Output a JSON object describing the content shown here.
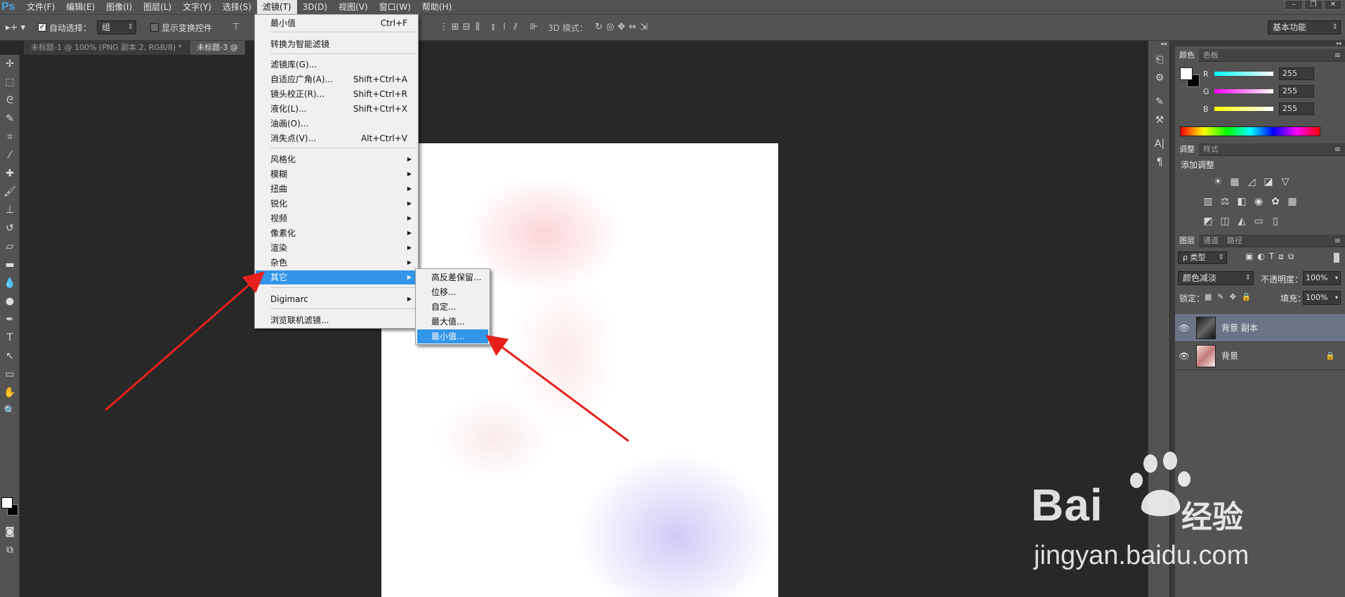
{
  "app": {
    "logo": "Ps"
  },
  "menubar": {
    "items": [
      "文件(F)",
      "编辑(E)",
      "图像(I)",
      "图层(L)",
      "文字(Y)",
      "选择(S)",
      "滤镜(T)",
      "3D(D)",
      "视图(V)",
      "窗口(W)",
      "帮助(H)"
    ],
    "active_index": 6
  },
  "options": {
    "auto_select_label": "自动选择：",
    "auto_select_value": "组",
    "show_transform_label": "显示变换控件",
    "mode_3d_label": "3D 模式：",
    "workspace": "基本功能"
  },
  "tabs": [
    "未标题-1 @ 100% (PNG 副本 2, RGB/8) *",
    "未标题-3 @"
  ],
  "filter_menu": {
    "last_filter": {
      "label": "最小值",
      "shortcut": "Ctrl+F"
    },
    "convert_smart": "转换为智能滤镜",
    "gallery": {
      "label": "滤镜库(G)..."
    },
    "adaptive_wide": {
      "label": "自适应广角(A)...",
      "shortcut": "Shift+Ctrl+A"
    },
    "lens_correction": {
      "label": "镜头校正(R)...",
      "shortcut": "Shift+Ctrl+R"
    },
    "liquify": {
      "label": "液化(L)...",
      "shortcut": "Shift+Ctrl+X"
    },
    "oil_paint": {
      "label": "油画(O)..."
    },
    "vanishing_point": {
      "label": "消失点(V)...",
      "shortcut": "Alt+Ctrl+V"
    },
    "stylize": "风格化",
    "blur": "模糊",
    "distort": "扭曲",
    "sharpen": "锐化",
    "video": "视频",
    "pixelate": "像素化",
    "render": "渲染",
    "noise": "杂色",
    "other": "其它",
    "digimarc": "Digimarc",
    "browse_online": "浏览联机滤镜..."
  },
  "other_submenu": {
    "high_pass": "高反差保留...",
    "offset": "位移...",
    "custom": "自定...",
    "maximum": "最大值...",
    "minimum": "最小值..."
  },
  "color_panel": {
    "tabs": [
      "颜色",
      "色板"
    ],
    "r_label": "R",
    "g_label": "G",
    "b_label": "B",
    "r": "255",
    "g": "255",
    "b": "255",
    "foreground": "#ffffff",
    "background": "#000000"
  },
  "adjust_panel": {
    "tabs": [
      "调整",
      "样式"
    ],
    "title": "添加调整"
  },
  "layers_panel": {
    "tabs": [
      "图层",
      "通道",
      "路径"
    ],
    "filter_type": "ρ 类型",
    "blend_mode": "颜色减淡",
    "opacity_label": "不透明度：",
    "opacity": "100%",
    "lock_label": "锁定：",
    "fill_label": "填充：",
    "fill": "100%",
    "layers": [
      {
        "name": "背景 副本",
        "selected": true
      },
      {
        "name": "背景",
        "locked": true
      }
    ]
  },
  "colors": {
    "highlight": "#3295e8",
    "annotation_arrow": "#e8201c",
    "panel_bg": "#535353",
    "canvas_bg": "#282828"
  },
  "watermark": {
    "brand": "Bai",
    "brand2": "经验",
    "url": "jingyan.baidu.com"
  }
}
